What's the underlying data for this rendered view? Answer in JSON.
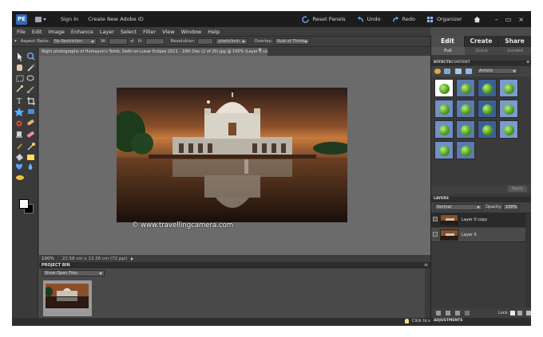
{
  "titlebar": {
    "logo": "PE",
    "sign_in": "Sign In",
    "create_id": "Create New Adobe ID",
    "reset_panels": "Reset Panels",
    "undo": "Undo",
    "redo": "Redo",
    "organizer": "Organizer",
    "minimize": "–",
    "restore": "▭",
    "close": "×"
  },
  "menu": [
    "File",
    "Edit",
    "Image",
    "Enhance",
    "Layer",
    "Select",
    "Filter",
    "View",
    "Window",
    "Help"
  ],
  "options": {
    "aspect_label": "Aspect Ratio:",
    "aspect_value": "No Restriction",
    "w_label": "W:",
    "h_label": "H:",
    "resolution_label": "Resolution:",
    "resolution_unit": "pixels/inch",
    "overlay_label": "Overlay:",
    "overlay_value": "Rule of Thirds"
  },
  "document": {
    "tab_title": "Night photographs of Humayun's Tomb, Delhi on Lunar Eclipse 2011 - 10th Dec (2 of 20).jpg @ 100% (Layer 0 copy, RGB/8*) *",
    "close": "×",
    "watermark": "© www.travellingcamera.com",
    "zoom": "100%",
    "dimensions": "22.58 cm x 13.26 cm (72 ppi)"
  },
  "project_bin": {
    "header": "PROJECT BIN",
    "show_select": "Show Open Files"
  },
  "tip": "Click to see how to crop photos for better composition.",
  "panel": {
    "mode_tabs": [
      "Edit",
      "Create",
      "Share"
    ],
    "active_mode": "Edit",
    "sub_tabs": [
      "Full",
      "Quick",
      "Guided"
    ],
    "active_sub": "Full",
    "effects_header": "EFFECTS",
    "content_header": "CONTENT",
    "effect_category": "Artistic",
    "apply": "Apply",
    "layers_header": "LAYERS",
    "blend_mode": "Normal",
    "opacity_label": "Opacity:",
    "opacity_value": "100%",
    "layers": [
      {
        "name": "Layer 0 copy"
      },
      {
        "name": "Layer 0"
      }
    ],
    "lock_label": "Lock:",
    "adjustments_header": "ADJUSTMENTS"
  },
  "colors": {
    "accent_blue": "#2f6bbf",
    "panel_dark": "#3a3a3a",
    "canvas_gray": "#6b6b6b"
  },
  "icons": [
    "move-tool-icon",
    "zoom-tool-icon",
    "hand-tool-icon",
    "eyedropper-icon",
    "marquee-icon",
    "lasso-icon",
    "magic-wand-icon",
    "selection-brush-icon",
    "type-tool-icon",
    "crop-tool-icon",
    "cookie-cutter-icon",
    "straighten-icon",
    "red-eye-icon",
    "healing-brush-icon",
    "clone-stamp-icon",
    "eraser-icon",
    "brush-tool-icon",
    "smart-brush-icon",
    "paint-bucket-icon",
    "gradient-icon",
    "shape-tool-icon",
    "blur-icon",
    "sponge-icon",
    "color-swatch-icon"
  ]
}
